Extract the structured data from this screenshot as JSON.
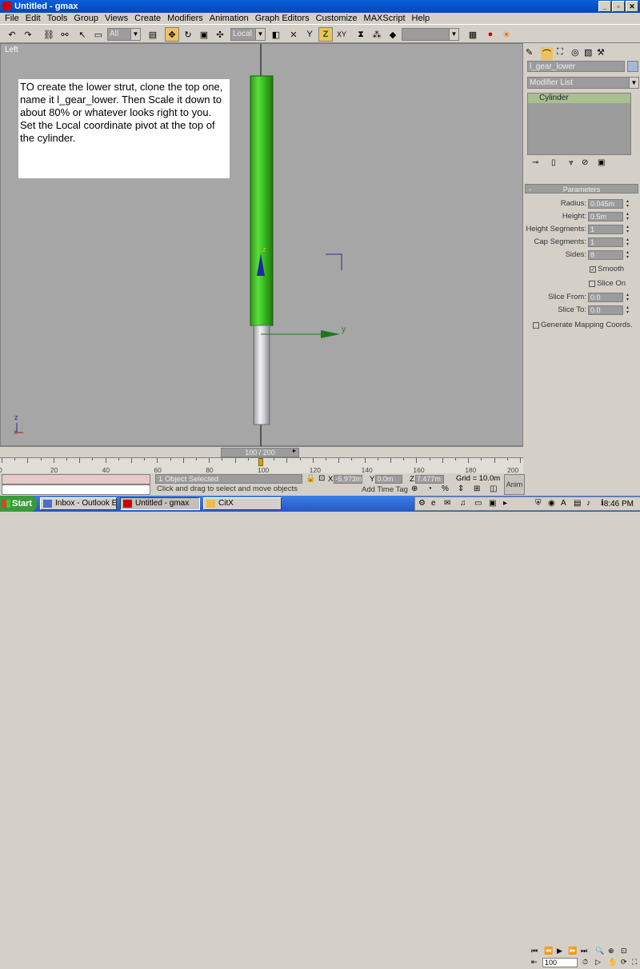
{
  "window": {
    "title": "Untitled - gmax"
  },
  "menu": [
    "File",
    "Edit",
    "Tools",
    "Group",
    "Views",
    "Create",
    "Modifiers",
    "Animation",
    "Graph Editors",
    "Customize",
    "MAXScript",
    "Help"
  ],
  "toolbar": {
    "filter": "All",
    "refcoord": "Local"
  },
  "viewport": {
    "label": "Left",
    "note": "TO create the lower strut, clone the top one, name it l_gear_lower.  Then Scale it down to about 80% or whatever looks right to you.  Set the Local coordinate pivot at the top of the cylinder.",
    "axis_y": "y",
    "axis_z": "z",
    "corner_z": "z",
    "corner_x": "x"
  },
  "command_panel": {
    "object_name": "l_gear_lower",
    "modifier_list": "Modifier List",
    "stack_item": "Cylinder",
    "rollout": "Parameters",
    "params": [
      {
        "label": "Radius:",
        "value": "0.045m"
      },
      {
        "label": "Height:",
        "value": "0.5m"
      },
      {
        "label": "Height Segments:",
        "value": "1"
      },
      {
        "label": "Cap Segments:",
        "value": "1"
      },
      {
        "label": "Sides:",
        "value": "8"
      }
    ],
    "smooth": "Smooth",
    "slice_on": "Slice On",
    "slice_from": {
      "label": "Slice From:",
      "value": "0.0"
    },
    "slice_to": {
      "label": "Slice To:",
      "value": "0.0"
    },
    "gen_mapping": "Generate Mapping Coords."
  },
  "timeline": {
    "frame": "100 / 200",
    "ticks": [
      "0",
      "20",
      "40",
      "60",
      "80",
      "100",
      "120",
      "140",
      "160",
      "180",
      "200"
    ]
  },
  "status": {
    "selected": "1 Object Selected",
    "prompt": "Click and drag to select and move objects",
    "x": "-5.973m",
    "y": "0.0m",
    "z": "7.477m",
    "grid": "Grid = 10.0m",
    "add_time_tag": "Add Time Tag",
    "anim": "Anim",
    "frame_field": "100"
  },
  "taskbar": {
    "start": "Start",
    "tasks": [
      "Inbox - Outlook E...",
      "Untitled - gmax",
      "CitX"
    ],
    "clock": "8:46 PM"
  }
}
